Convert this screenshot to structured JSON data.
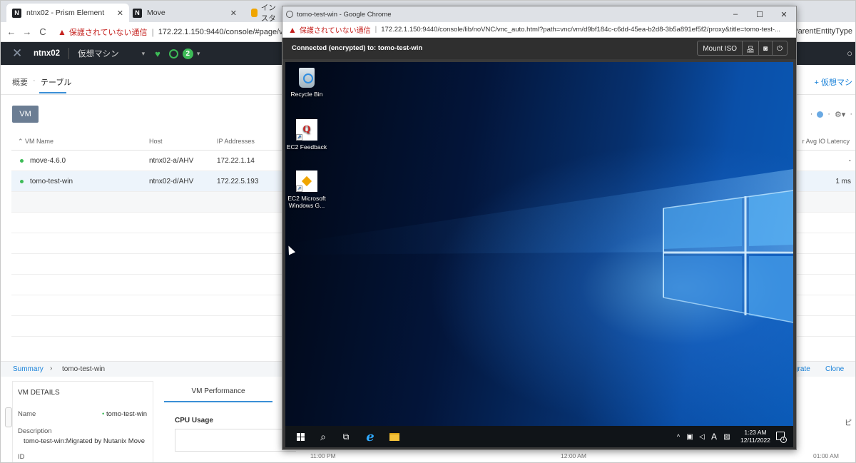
{
  "browser": {
    "tabs": [
      {
        "label": "ntnx02 - Prism Element",
        "icon": "nutanix-icon"
      },
      {
        "label": "Move",
        "icon": "nutanix-icon"
      },
      {
        "label": "インスタ",
        "icon": "aws-icon"
      }
    ],
    "insecure_label": "保護されていない通信",
    "url": "172.22.1.150:9440/console/#page/vms/table",
    "url_right_fragment": "nParentEntityType"
  },
  "prism": {
    "cluster_name": "ntnx02",
    "menu": "仮想マシン",
    "alert_count": "2",
    "tabs": [
      "概要",
      "テーブル"
    ],
    "add_vm_link": "+ 仮想マシ",
    "vm_button": "VM",
    "columns": [
      "VM Name",
      "Host",
      "IP Addresses"
    ],
    "right_column": "r Avg IO Latency",
    "rows": [
      {
        "name": "move-4.6.0",
        "host": "ntnx02-a/AHV",
        "ip": "172.22.1.14",
        "latency": "-"
      },
      {
        "name": "tomo-test-win",
        "host": "ntnx02-d/AHV",
        "ip": "172.22.5.193",
        "latency": "1 ms"
      }
    ],
    "summary": {
      "link": "Summary",
      "vm_name": "tomo-test-win",
      "migrate": "grate",
      "clone": "Clone"
    },
    "details": {
      "heading": "VM DETAILS",
      "name_label": "Name",
      "name_value": "tomo-test-win",
      "description_label": "Description",
      "description_value": "tomo-test-win:Migrated by Nutanix Move",
      "id_label": "ID"
    },
    "performance": {
      "tab": "VM Performance",
      "cpu_label": "CPU Usage",
      "time_labels": [
        "11:00 PM",
        "12:00 AM",
        "01:00 AM"
      ],
      "right_glyph": "ピ"
    }
  },
  "popup": {
    "title": "tomo-test-win - Google Chrome",
    "insecure_label": "保護されていない通信",
    "url": "172.22.1.150:9440/console/lib/noVNC/vnc_auto.html?path=vnc/vm/d9bf184c-c6dd-45ea-b2d8-3b5a891ef5f2/proxy&title=tomo-test-...",
    "status": "Connected (encrypted) to: tomo-test-win",
    "mount_iso": "Mount ISO"
  },
  "desktop": {
    "icons": [
      {
        "label": "Recycle Bin"
      },
      {
        "label": "EC2 Feedback"
      },
      {
        "label": "EC2 Microsoft Windows G..."
      }
    ],
    "clock_time": "1:23 AM",
    "clock_date": "12/11/2022",
    "notification_count": "1",
    "ime_label": "A"
  },
  "colors": {
    "accent": "#1a82d9",
    "status_green": "#3dbb57",
    "prism_header": "#22272e",
    "insecure_red": "#c5221f"
  }
}
